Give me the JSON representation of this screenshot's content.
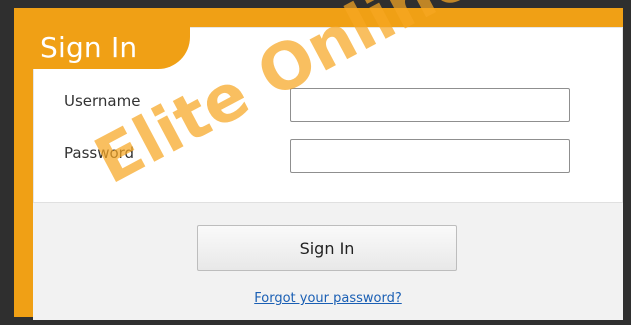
{
  "dialog": {
    "title": "Sign In",
    "username_label": "Username",
    "password_label": "Password",
    "username_value": "",
    "password_value": "",
    "signin_button_label": "Sign In",
    "forgot_link_label": "Forgot your password?"
  },
  "watermark": {
    "text": "Elite Online"
  },
  "colors": {
    "accent": "#f0a015",
    "background": "#2f2f2f",
    "link": "#1a5fb4"
  }
}
